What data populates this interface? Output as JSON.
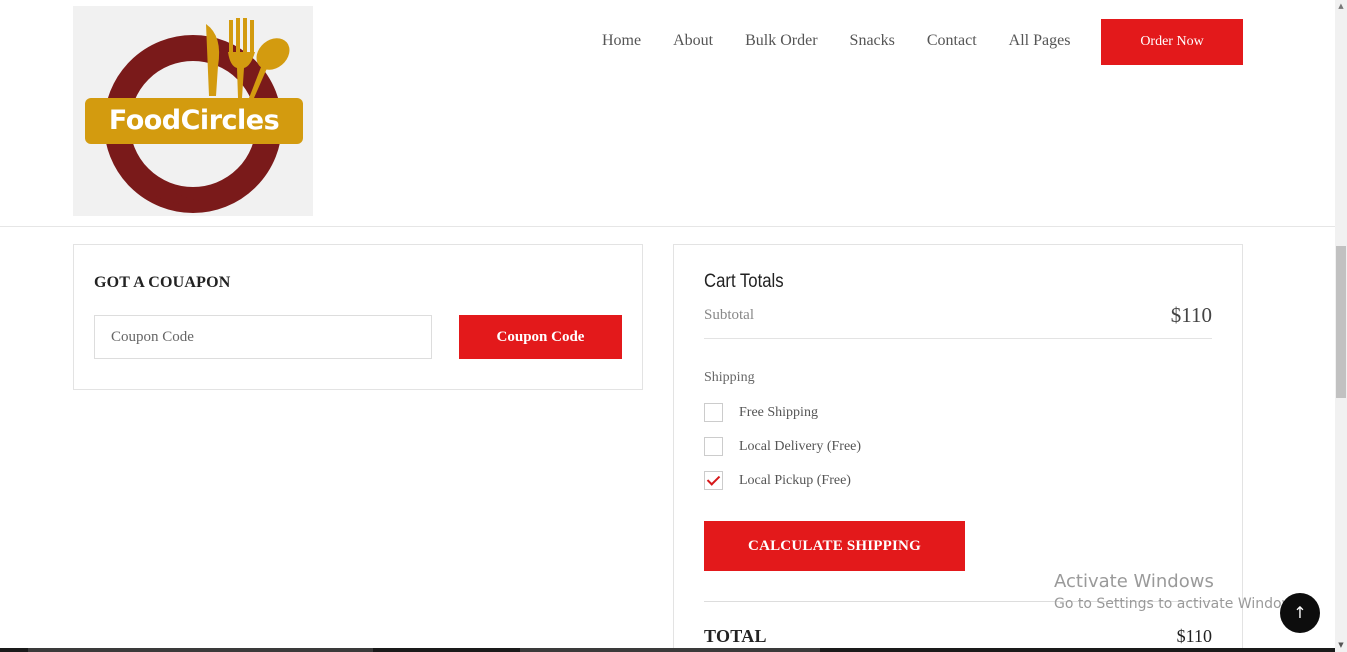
{
  "brand": {
    "logo_text": "FoodCircles"
  },
  "nav": {
    "items": [
      {
        "label": "Home"
      },
      {
        "label": "About"
      },
      {
        "label": "Bulk Order"
      },
      {
        "label": "Snacks"
      },
      {
        "label": "Contact"
      },
      {
        "label": "All Pages"
      }
    ],
    "order_button": "Order Now"
  },
  "coupon": {
    "title": "GOT A COUAPON",
    "input_placeholder": "Coupon Code",
    "button_label": "Coupon Code"
  },
  "cart": {
    "title": "Cart Totals",
    "subtotal_label": "Subtotal",
    "subtotal_value": "$110",
    "shipping_label": "Shipping",
    "shipping_options": [
      {
        "label": "Free Shipping",
        "checked": false
      },
      {
        "label": "Local Delivery (Free)",
        "checked": false
      },
      {
        "label": "Local Pickup (Free)",
        "checked": true
      }
    ],
    "calculate_button": "CALCULATE SHIPPING",
    "total_label": "TOTAL",
    "total_value": "$110"
  },
  "watermark": {
    "line1": "Activate Windows",
    "line2": "Go to Settings to activate Windows."
  },
  "back_to_top_icon": "arrow-up-icon",
  "colors": {
    "accent": "#e3191b",
    "logo_ring": "#7a1a1a",
    "logo_gold": "#d39b0f"
  }
}
